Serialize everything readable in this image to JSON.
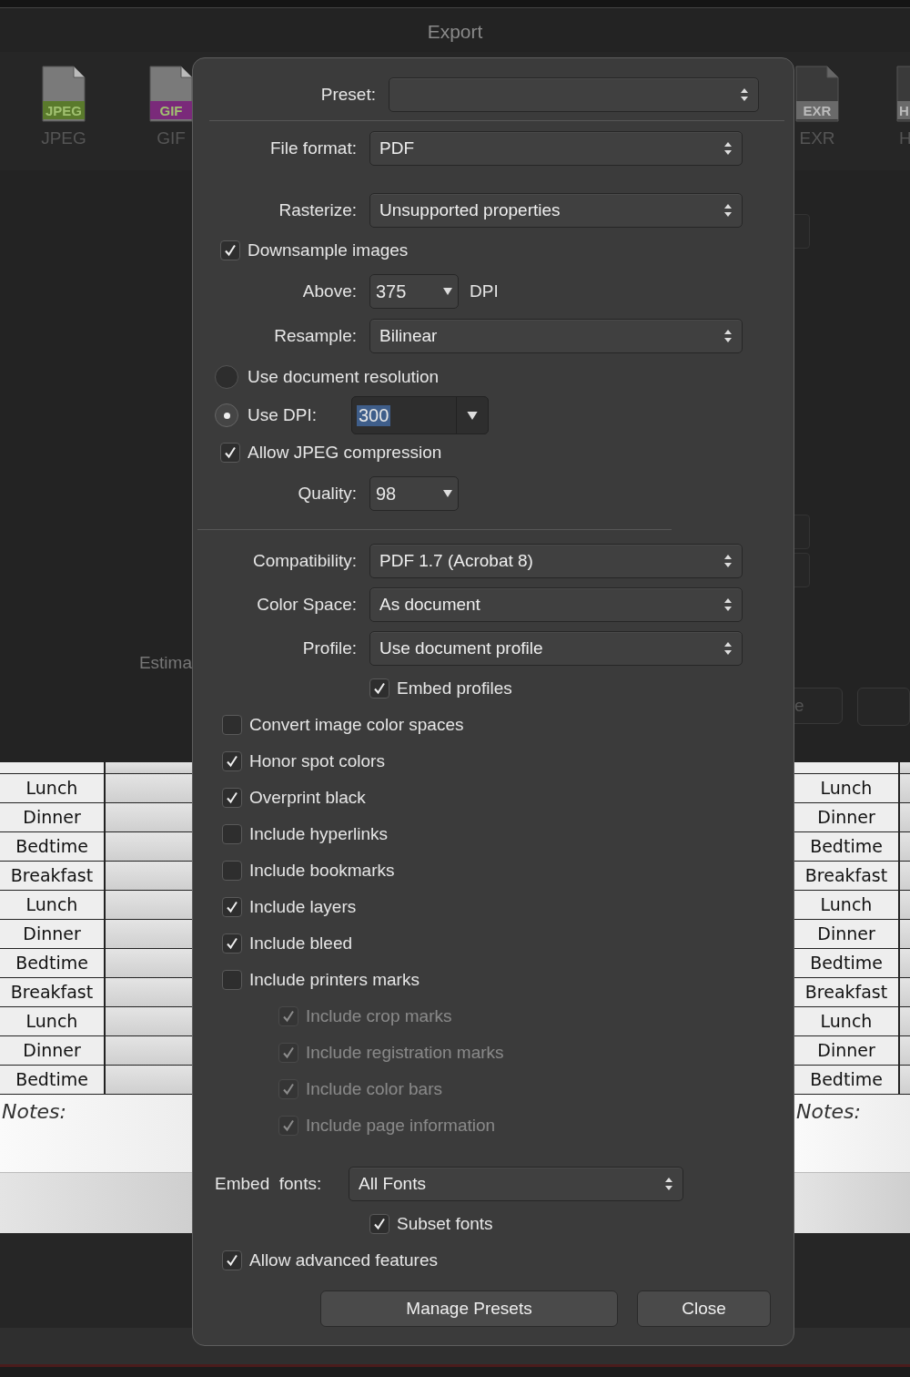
{
  "window": {
    "title": "Export"
  },
  "formats": [
    {
      "tag": "JPEG",
      "label": "JPEG",
      "color": "#5a7a2c"
    },
    {
      "tag": "GIF",
      "label": "GIF",
      "color": "#7a2a7a"
    },
    {
      "tag": "EXR",
      "label": "EXR",
      "color": "#6a6a6a"
    },
    {
      "tag": "H",
      "label": "H",
      "color": "#6a6a6a"
    }
  ],
  "background": {
    "estimate_label": "Estima",
    "button_label": "e"
  },
  "document": {
    "pages": [
      {
        "rows": [
          "Lunch",
          "Dinner",
          "Bedtime",
          "Breakfast",
          "Lunch",
          "Dinner",
          "Bedtime",
          "Breakfast",
          "Lunch",
          "Dinner",
          "Bedtime"
        ],
        "notes": "Notes:"
      },
      {
        "rows": [
          "Lunch",
          "Dinner",
          "Bedtime",
          "Breakfast",
          "Lunch",
          "Dinner",
          "Bedtime",
          "Breakfast",
          "Lunch",
          "Dinner",
          "Bedtime"
        ],
        "notes": "Notes:"
      }
    ]
  },
  "dialog": {
    "sections": [
      {
        "ruled": true,
        "items": [
          {
            "kind": "preset",
            "label": "Preset:"
          }
        ]
      },
      {
        "ruled": false,
        "items": [
          {
            "kind": "select",
            "label": "File format:",
            "value": "PDF"
          }
        ]
      },
      {
        "ruled": true,
        "items": [
          {
            "kind": "select",
            "label": "Rasterize:",
            "value": "Unsupported properties"
          },
          {
            "kind": "checkbox",
            "label": "Downsample images",
            "checked": true,
            "disabled": false
          },
          {
            "kind": "combo",
            "label": "Above:",
            "value": "375",
            "unit": "DPI"
          },
          {
            "kind": "select",
            "label": "Resample:",
            "value": "Bilinear"
          },
          {
            "kind": "radio",
            "label": "Use document resolution",
            "selected": false
          },
          {
            "kind": "radio_combo",
            "label": "Use DPI:",
            "selected": true,
            "value": "300",
            "highlighted": true
          },
          {
            "kind": "checkbox",
            "label": "Allow JPEG compression",
            "checked": true,
            "disabled": false
          },
          {
            "kind": "combo",
            "label": "Quality:",
            "value": "98"
          }
        ]
      },
      {
        "ruled": false,
        "items": [
          {
            "kind": "select",
            "label": "Compatibility:",
            "value": "PDF 1.7 (Acrobat 8)"
          },
          {
            "kind": "select",
            "label": "Color Space:",
            "value": "As document"
          },
          {
            "kind": "select",
            "label": "Profile:",
            "value": "Use document profile"
          },
          {
            "kind": "option_checkbox",
            "label": "Embed profiles",
            "checked": true,
            "disabled": false
          },
          {
            "kind": "checkbox",
            "label": "Convert image color spaces",
            "checked": false,
            "disabled": false
          },
          {
            "kind": "checkbox",
            "label": "Honor spot colors",
            "checked": true,
            "disabled": false
          },
          {
            "kind": "checkbox",
            "label": "Overprint black",
            "checked": true,
            "disabled": false
          },
          {
            "kind": "checkbox",
            "label": "Include hyperlinks",
            "checked": false,
            "disabled": false
          },
          {
            "kind": "checkbox",
            "label": "Include bookmarks",
            "checked": false,
            "disabled": false
          },
          {
            "kind": "checkbox",
            "label": "Include layers",
            "checked": true,
            "disabled": false
          },
          {
            "kind": "checkbox",
            "label": "Include bleed",
            "checked": true,
            "disabled": false
          },
          {
            "kind": "checkbox",
            "label": "Include printers marks",
            "checked": false,
            "disabled": false,
            "children": [
              {
                "label": "Include crop marks",
                "checked": true,
                "disabled": true
              },
              {
                "label": "Include registration marks",
                "checked": true,
                "disabled": true
              },
              {
                "label": "Include color bars",
                "checked": true,
                "disabled": true
              },
              {
                "label": "Include page information",
                "checked": true,
                "disabled": true
              }
            ]
          }
        ]
      },
      {
        "ruled": false,
        "items": [
          {
            "kind": "font_select",
            "label": "Embed  fonts:",
            "value": "All Fonts"
          },
          {
            "kind": "option_checkbox",
            "label": "Subset fonts",
            "checked": true,
            "disabled": false
          },
          {
            "kind": "checkbox",
            "label": "Allow advanced features",
            "checked": true,
            "disabled": false
          }
        ]
      }
    ],
    "buttons": [
      "Manage Presets",
      "Close"
    ]
  }
}
